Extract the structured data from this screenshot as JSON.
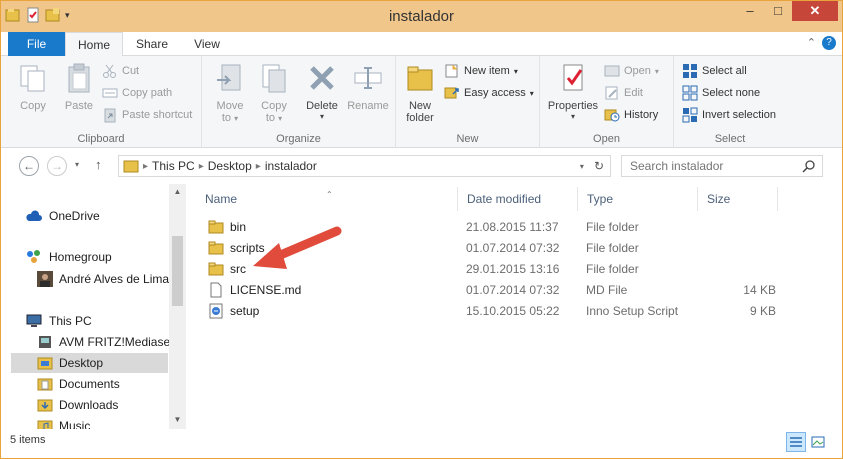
{
  "window": {
    "title": "instalador"
  },
  "ribbon_tabs": {
    "file": "File",
    "home": "Home",
    "share": "Share",
    "view": "View"
  },
  "clipboard": {
    "copy": "Copy",
    "paste": "Paste",
    "cut": "Cut",
    "copy_path": "Copy path",
    "paste_shortcut": "Paste shortcut",
    "label": "Clipboard"
  },
  "organize": {
    "move_to_1": "Move",
    "move_to_2": "to",
    "copy_to_1": "Copy",
    "copy_to_2": "to",
    "delete": "Delete",
    "rename": "Rename",
    "label": "Organize"
  },
  "new": {
    "new_folder_1": "New",
    "new_folder_2": "folder",
    "new_item": "New item",
    "easy_access": "Easy access",
    "label": "New"
  },
  "open": {
    "properties": "Properties",
    "open": "Open",
    "edit": "Edit",
    "history": "History",
    "label": "Open"
  },
  "select": {
    "select_all": "Select all",
    "select_none": "Select none",
    "invert_selection": "Invert selection",
    "label": "Select"
  },
  "address": {
    "crumbs": [
      "This PC",
      "Desktop",
      "instalador"
    ]
  },
  "search": {
    "placeholder": "Search instalador"
  },
  "nav": {
    "onedrive": "OneDrive",
    "homegroup": "Homegroup",
    "user": "André Alves de Lima",
    "thispc": "This PC",
    "mediaserver": "AVM FRITZ!Mediaser",
    "desktop": "Desktop",
    "documents": "Documents",
    "downloads": "Downloads",
    "music": "Music"
  },
  "columns": {
    "name": "Name",
    "date": "Date modified",
    "type": "Type",
    "size": "Size"
  },
  "files": [
    {
      "name": "bin",
      "date": "21.08.2015 11:37",
      "type": "File folder",
      "size": "",
      "icon": "folder-icon"
    },
    {
      "name": "scripts",
      "date": "01.07.2014 07:32",
      "type": "File folder",
      "size": "",
      "icon": "folder-icon"
    },
    {
      "name": "src",
      "date": "29.01.2015 13:16",
      "type": "File folder",
      "size": "",
      "icon": "folder-icon"
    },
    {
      "name": "LICENSE.md",
      "date": "01.07.2014 07:32",
      "type": "MD File",
      "size": "14 KB",
      "icon": "document-icon"
    },
    {
      "name": "setup",
      "date": "15.10.2015 05:22",
      "type": "Inno Setup Script",
      "size": "9 KB",
      "icon": "script-icon"
    }
  ],
  "status": {
    "items": "5 items"
  },
  "colors": {
    "file_tab": "#1979ca",
    "titlebar": "#f0c68a",
    "close": "#c7463a",
    "arrow": "#e04b3c",
    "folder": "#e8c14a"
  }
}
